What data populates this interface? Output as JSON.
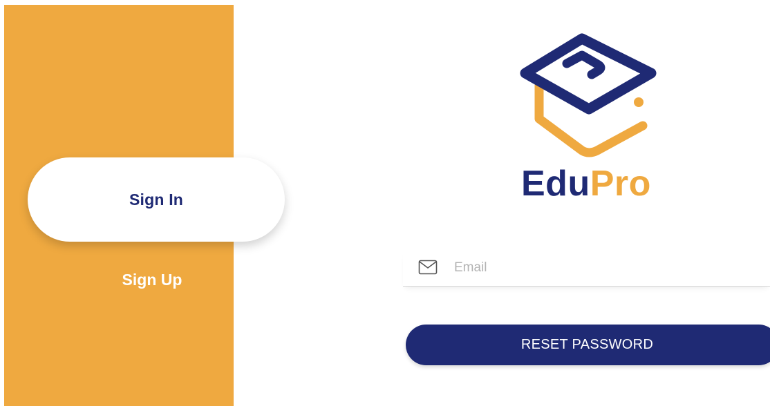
{
  "sidebar": {
    "tabs": [
      {
        "label": "Sign In",
        "active": true
      },
      {
        "label": "Sign Up",
        "active": false
      }
    ]
  },
  "brand": {
    "name_part1": "Edu",
    "name_part2": "Pro",
    "logo_icon": "graduation-cap-icon"
  },
  "form": {
    "email": {
      "icon": "mail-icon",
      "placeholder": "Email",
      "value": ""
    },
    "submit_label": "RESET PASSWORD"
  },
  "colors": {
    "accent_orange": "#efa940",
    "brand_navy": "#1f2a74",
    "background": "#ffffff"
  }
}
